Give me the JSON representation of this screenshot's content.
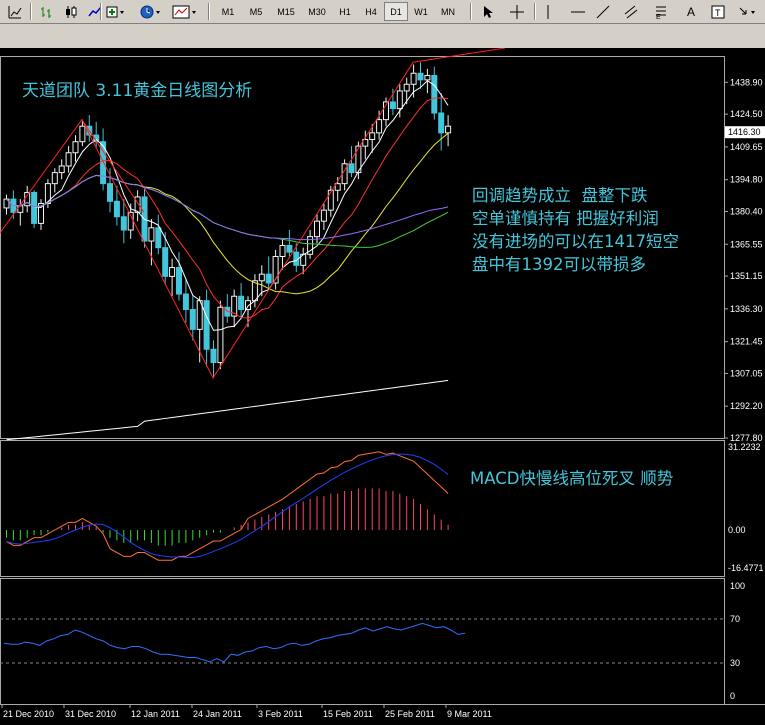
{
  "toolbar": {
    "timeframes": [
      "M1",
      "M5",
      "M15",
      "M30",
      "H1",
      "H4",
      "D1",
      "W1",
      "MN"
    ],
    "active_timeframe": "D1",
    "text_tool": "A"
  },
  "annotations": {
    "title": "天道团队 3.11黄金日线图分析",
    "analysis_lines": [
      "回调趋势成立  盘整下跌",
      "空单谨慎持有 把握好利润",
      "没有进场的可以在1417短空",
      "盘中有1392可以带损多"
    ],
    "macd_note": "MACD快慢线高位死叉 顺势"
  },
  "chart_data": {
    "type": "candlestick",
    "main_axis": {
      "labels": [
        "1438.90",
        "1424.50",
        "1416.30",
        "1409.65",
        "1394.80",
        "1380.40",
        "1365.55",
        "1351.15",
        "1336.30",
        "1321.45",
        "1307.05",
        "1292.20",
        "1277.80"
      ],
      "current": "1416.30",
      "ylim": [
        1277.8,
        1449
      ]
    },
    "macd_axis": {
      "labels": [
        "31.2232",
        "0.00",
        "-16.4771"
      ]
    },
    "osc_axis": {
      "labels": [
        "100",
        "70",
        "30",
        "0"
      ],
      "levels": [
        70,
        30
      ]
    },
    "x_labels": [
      "21 Dec 2010",
      "31 Dec 2010",
      "12 Jan 2011",
      "24 Jan 2011",
      "3 Feb 2011",
      "15 Feb 2011",
      "25 Feb 2011",
      "9 Mar 2011"
    ],
    "candles": [
      [
        1382,
        1388,
        1379,
        1386
      ],
      [
        1386,
        1390,
        1377,
        1380
      ],
      [
        1380,
        1386,
        1374,
        1383
      ],
      [
        1383,
        1392,
        1380,
        1389
      ],
      [
        1389,
        1390,
        1373,
        1375
      ],
      [
        1375,
        1386,
        1372,
        1384
      ],
      [
        1384,
        1395,
        1382,
        1393
      ],
      [
        1393,
        1400,
        1389,
        1398
      ],
      [
        1398,
        1404,
        1395,
        1401
      ],
      [
        1401,
        1410,
        1398,
        1407
      ],
      [
        1407,
        1415,
        1403,
        1412
      ],
      [
        1412,
        1422,
        1410,
        1419
      ],
      [
        1419,
        1424,
        1412,
        1415
      ],
      [
        1415,
        1421,
        1409,
        1412
      ],
      [
        1412,
        1418,
        1390,
        1393
      ],
      [
        1393,
        1400,
        1380,
        1385
      ],
      [
        1385,
        1392,
        1374,
        1378
      ],
      [
        1378,
        1386,
        1366,
        1372
      ],
      [
        1372,
        1384,
        1368,
        1380
      ],
      [
        1380,
        1390,
        1376,
        1387
      ],
      [
        1387,
        1391,
        1364,
        1367
      ],
      [
        1367,
        1377,
        1356,
        1373
      ],
      [
        1373,
        1379,
        1361,
        1364
      ],
      [
        1364,
        1371,
        1347,
        1351
      ],
      [
        1351,
        1359,
        1342,
        1355
      ],
      [
        1355,
        1362,
        1340,
        1343
      ],
      [
        1343,
        1350,
        1330,
        1336
      ],
      [
        1336,
        1342,
        1322,
        1327
      ],
      [
        1327,
        1342,
        1312,
        1340
      ],
      [
        1340,
        1345,
        1310,
        1318
      ],
      [
        1318,
        1322,
        1305,
        1312
      ],
      [
        1312,
        1340,
        1309,
        1337
      ],
      [
        1337,
        1343,
        1330,
        1333
      ],
      [
        1333,
        1345,
        1328,
        1342
      ],
      [
        1342,
        1348,
        1332,
        1336
      ],
      [
        1336,
        1342,
        1328,
        1340
      ],
      [
        1340,
        1352,
        1337,
        1349
      ],
      [
        1349,
        1356,
        1342,
        1352
      ],
      [
        1352,
        1360,
        1345,
        1348
      ],
      [
        1348,
        1363,
        1345,
        1360
      ],
      [
        1360,
        1368,
        1354,
        1365
      ],
      [
        1365,
        1372,
        1360,
        1362
      ],
      [
        1362,
        1366,
        1353,
        1356
      ],
      [
        1356,
        1364,
        1352,
        1361
      ],
      [
        1361,
        1372,
        1359,
        1369
      ],
      [
        1369,
        1379,
        1366,
        1376
      ],
      [
        1376,
        1384,
        1372,
        1381
      ],
      [
        1381,
        1392,
        1378,
        1390
      ],
      [
        1390,
        1396,
        1385,
        1393
      ],
      [
        1393,
        1404,
        1390,
        1402
      ],
      [
        1402,
        1410,
        1396,
        1398
      ],
      [
        1398,
        1412,
        1395,
        1410
      ],
      [
        1410,
        1417,
        1404,
        1413
      ],
      [
        1413,
        1420,
        1407,
        1416
      ],
      [
        1416,
        1426,
        1413,
        1422
      ],
      [
        1422,
        1432,
        1419,
        1430
      ],
      [
        1430,
        1436,
        1424,
        1427
      ],
      [
        1427,
        1438,
        1423,
        1435
      ],
      [
        1435,
        1441,
        1429,
        1438
      ],
      [
        1438,
        1447,
        1432,
        1443
      ],
      [
        1443,
        1448,
        1436,
        1440
      ],
      [
        1440,
        1445,
        1434,
        1442
      ],
      [
        1442,
        1446,
        1422,
        1425
      ],
      [
        1425,
        1434,
        1408,
        1416
      ],
      [
        1416,
        1424,
        1410,
        1419
      ]
    ],
    "histogram": [
      -3,
      -4,
      -4,
      -3,
      -2,
      -2,
      -1,
      0,
      1,
      2,
      2,
      3,
      2,
      1,
      -1,
      -3,
      -4,
      -5,
      -5,
      -4,
      -4,
      -5,
      -6,
      -6,
      -6,
      -5,
      -5,
      -4,
      -3,
      -2,
      -1,
      -1,
      0,
      1,
      2,
      3,
      4,
      5,
      6,
      7,
      8,
      9,
      10,
      11,
      12,
      13,
      13,
      14,
      14,
      15,
      15,
      16,
      16,
      16,
      16,
      15,
      15,
      14,
      13,
      12,
      10,
      8,
      6,
      4,
      2
    ],
    "oscillator": [
      48,
      47,
      47,
      49,
      48,
      46,
      50,
      52,
      55,
      56,
      60,
      58,
      55,
      52,
      50,
      46,
      44,
      43,
      45,
      45,
      43,
      40,
      38,
      38,
      37,
      36,
      35,
      35,
      33,
      31,
      34,
      31,
      38,
      37,
      40,
      41,
      44,
      45,
      43,
      44,
      47,
      48,
      46,
      47,
      50,
      52,
      53,
      55,
      56,
      57,
      60,
      62,
      59,
      61,
      63,
      61,
      60,
      62,
      64,
      66,
      64,
      62,
      63,
      60,
      56,
      57
    ],
    "colors": {
      "bull": "#f2f2f2",
      "bear": "#43c6db",
      "hist_up": "#ff4466",
      "hist_down": "#33dd33"
    }
  }
}
